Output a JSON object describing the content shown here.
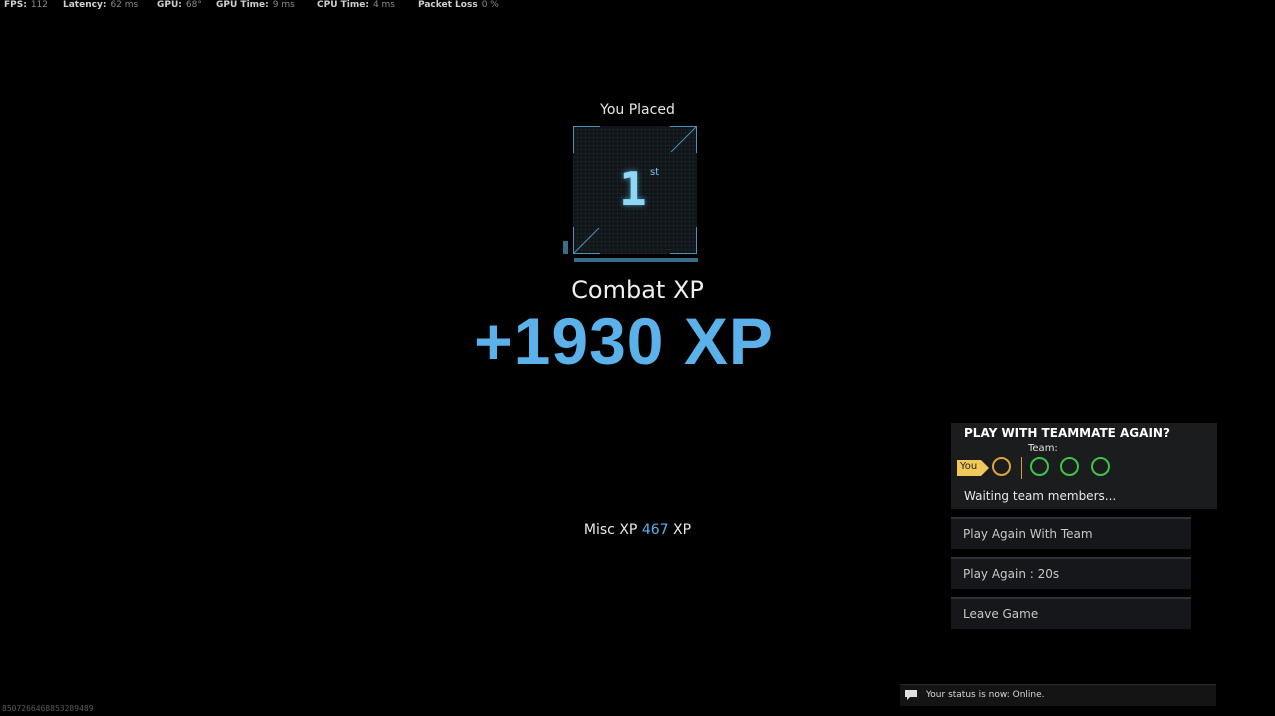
{
  "perf": {
    "fps_label": "FPS:",
    "fps_value": "112",
    "latency_label": "Latency:",
    "latency_value": "62 ms",
    "gpu_label": "GPU:",
    "gpu_value": "68°",
    "gpu_time_label": "GPU Time:",
    "gpu_time_value": "9 ms",
    "cpu_time_label": "CPU Time:",
    "cpu_time_value": "4 ms",
    "packet_loss_label": "Packet Loss",
    "packet_loss_value": "0 %"
  },
  "placement": {
    "label": "You Placed",
    "number": "1",
    "suffix": "st"
  },
  "xp": {
    "label": "Combat XP",
    "value": "+1930 XP"
  },
  "misc_xp": {
    "prefix": "Misc XP",
    "value": "467",
    "suffix": "XP"
  },
  "team": {
    "title": "PLAY WITH TEAMMATE AGAIN?",
    "sub": "Team:",
    "you_label": "You",
    "status": "Waiting team members...",
    "colors": {
      "you": "#e0a33a",
      "teammate": "#3ec44a",
      "tag": "#f1c95a"
    }
  },
  "menu": {
    "play_again_team": "Play Again With Team",
    "play_again": "Play Again : 20s",
    "leave": "Leave Game"
  },
  "toast": {
    "text": "Your status is now: Online."
  },
  "build_id": "8507266468853289489",
  "colors": {
    "accent": "#5bb1ea",
    "background": "#000000"
  }
}
